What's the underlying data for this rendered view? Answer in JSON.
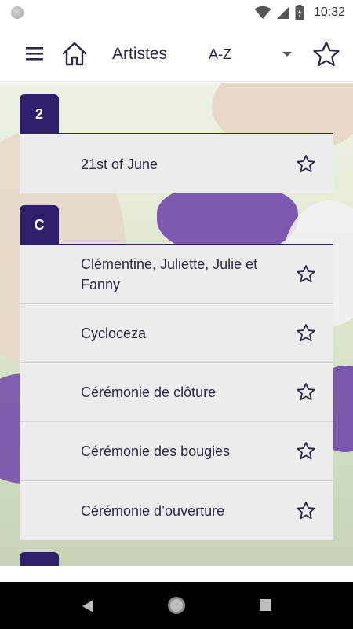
{
  "status_bar": {
    "time": "10:32",
    "icons": [
      "wifi-icon",
      "signal-icon",
      "battery-charging-icon"
    ]
  },
  "app_bar": {
    "menu_icon": "menu-icon",
    "home_icon": "home-icon",
    "title": "Artistes",
    "sort": {
      "selected": "A-Z"
    },
    "favorites_icon": "star-outline-icon"
  },
  "sections": [
    {
      "letter": "2",
      "items": [
        {
          "name": "21st of June"
        }
      ]
    },
    {
      "letter": "C",
      "items": [
        {
          "name": "Clémentine, Juliette, Julie et Fanny"
        },
        {
          "name": "Cycloceza"
        },
        {
          "name": "Cérémonie de clôture"
        },
        {
          "name": "Cérémonie des bougies"
        },
        {
          "name": "Cérémonie d’ouverture"
        }
      ]
    }
  ],
  "colors": {
    "accent": "#2e1f6b",
    "row_background": "#ececec",
    "text": "#2a2a45"
  },
  "nav_bar": {
    "icons": [
      "back-icon",
      "home-circle-icon",
      "recents-icon"
    ]
  }
}
